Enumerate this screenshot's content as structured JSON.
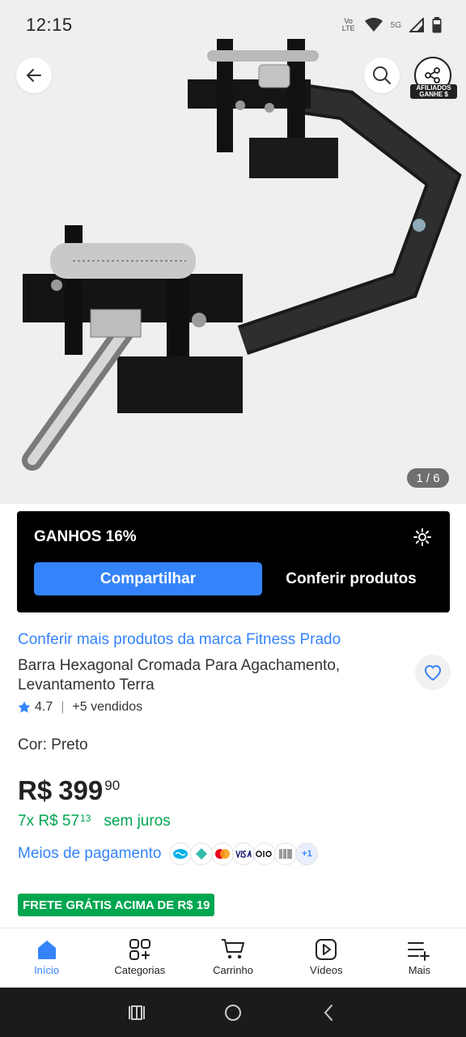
{
  "status": {
    "time": "12:15",
    "network": "5G",
    "volte": "Vo LTE"
  },
  "hero": {
    "image_counter": "1 / 6",
    "affiliate_label": "AFILIADOS GANHE $"
  },
  "affiliate": {
    "title": "GANHOS 16%",
    "share_label": "Compartilhar",
    "check_label": "Conferir produtos"
  },
  "product": {
    "brand_link": "Conferir mais produtos da marca Fitness Prado",
    "title": "Barra Hexagonal Cromada Para Agachamento, Levantamento Terra",
    "rating": "4.7",
    "sold": "+5 vendidos",
    "color": "Cor: Preto",
    "price_currency": "R$",
    "price_int": "399",
    "price_cents": "90",
    "installment_prefix": "7x R$ 57",
    "installment_cents": "13",
    "installment_suffix": "sem juros",
    "payment_link": "Meios de pagamento",
    "payment_more": "+1",
    "shipping": "FRETE GRÁTIS ACIMA DE R$ 19"
  },
  "nav": [
    {
      "label": "Início",
      "icon": "home-icon"
    },
    {
      "label": "Categorias",
      "icon": "categories-icon"
    },
    {
      "label": "Carrinho",
      "icon": "cart-icon"
    },
    {
      "label": "Vídeos",
      "icon": "video-icon"
    },
    {
      "label": "Mais",
      "icon": "menu-plus-icon"
    }
  ],
  "colors": {
    "accent": "#3483fa",
    "green": "#00a650",
    "card": "#000000"
  }
}
